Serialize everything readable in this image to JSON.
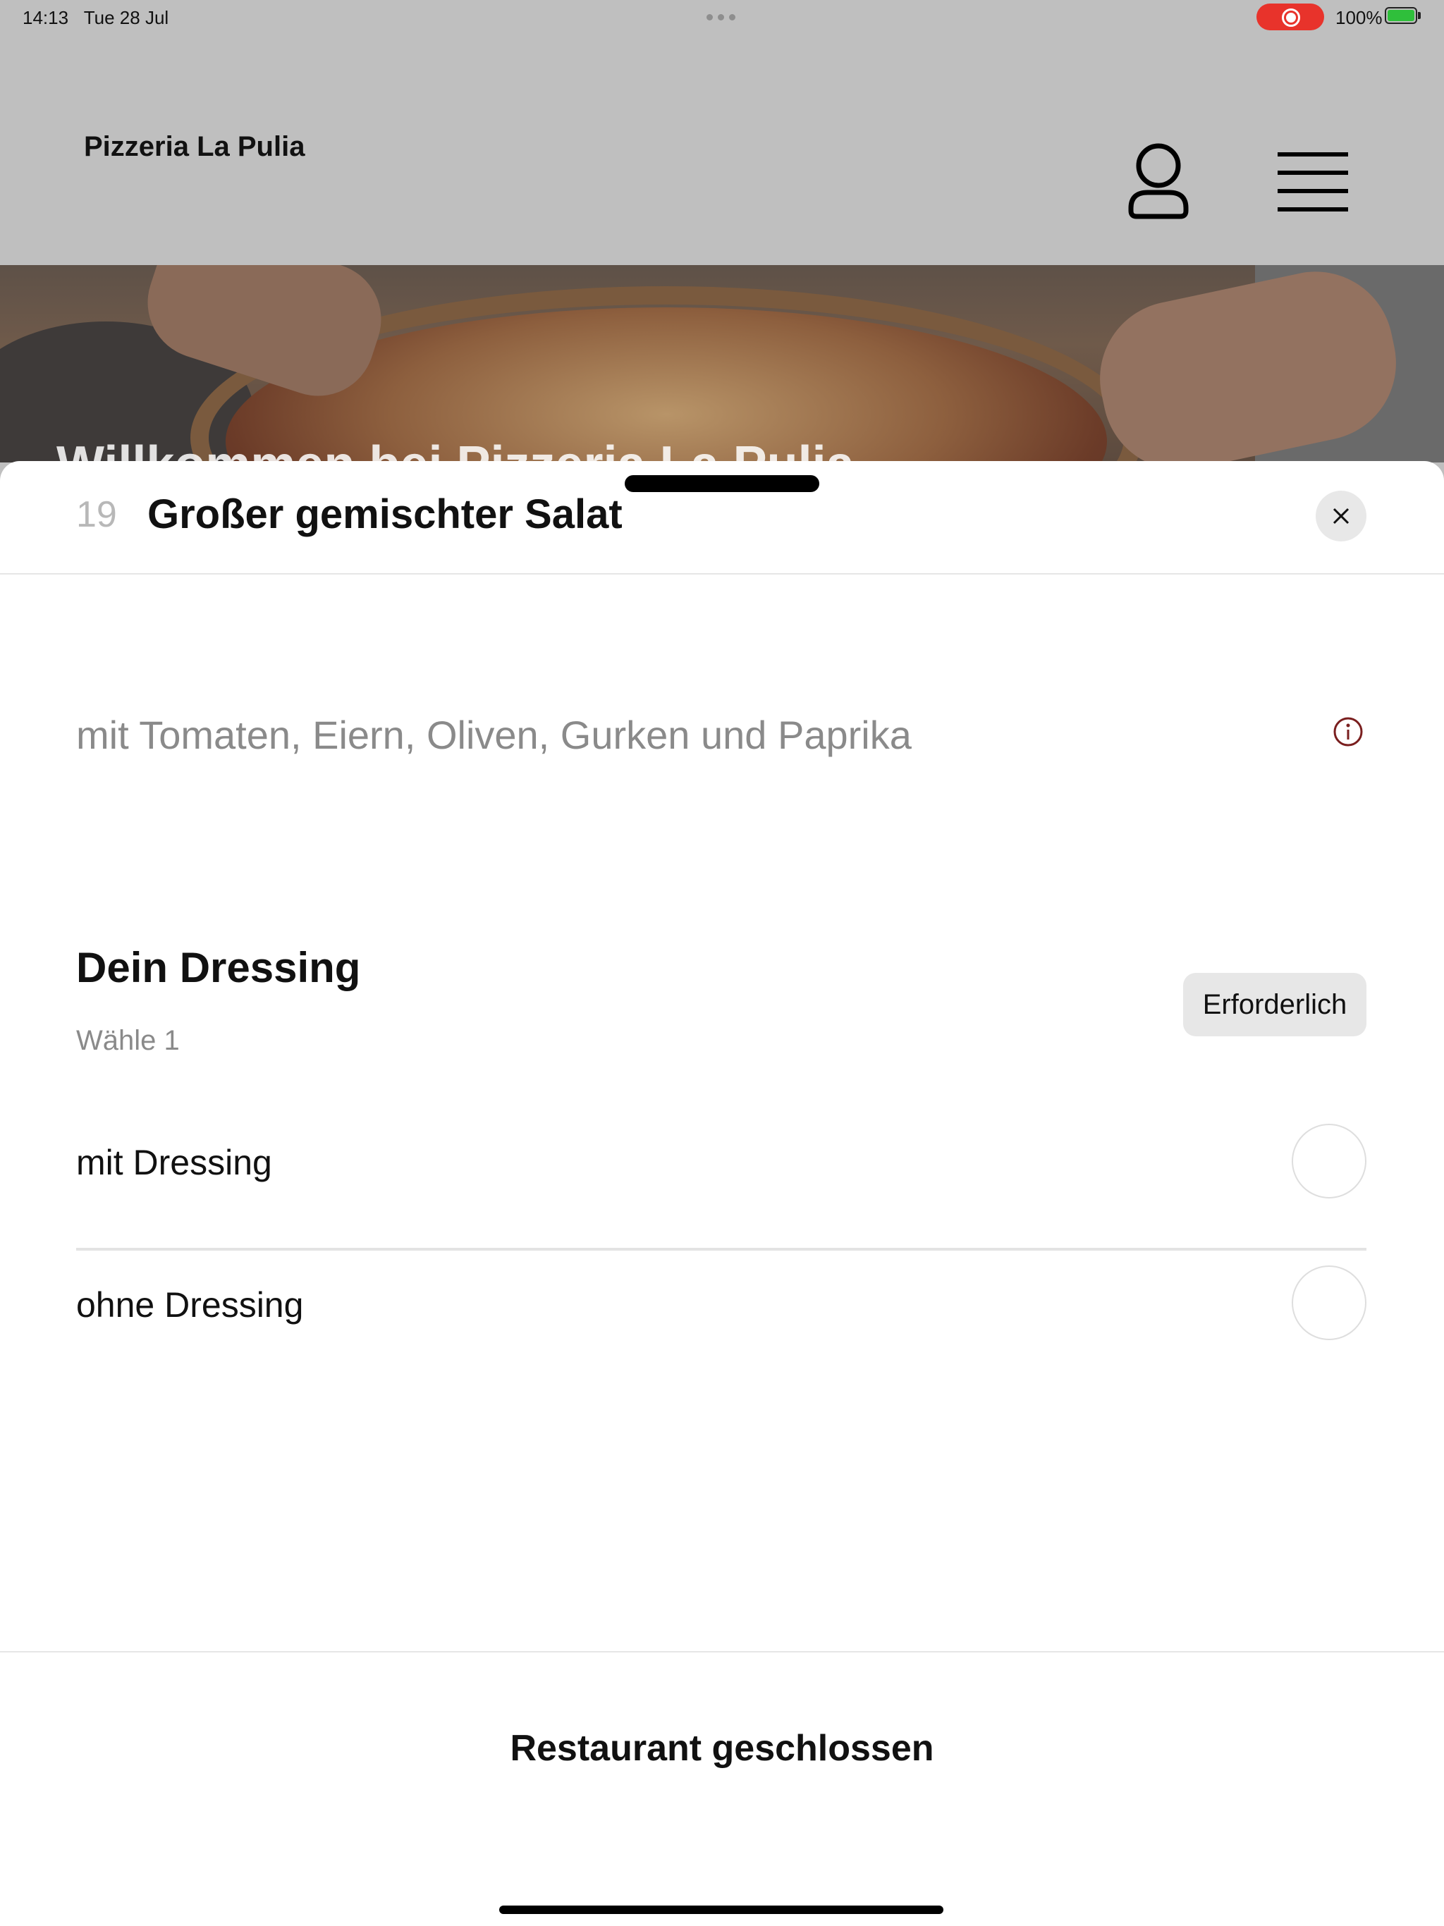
{
  "status_bar": {
    "time": "14:13",
    "date": "Tue 28 Jul",
    "battery": "100%",
    "recording_color": "#e8332b"
  },
  "header": {
    "brand": "Pizzeria La Pulia",
    "profile_icon": "person-icon",
    "menu_icon": "hamburger-icon"
  },
  "hero": {
    "title": "Willkommen bei Pizzeria La Pulia"
  },
  "sheet": {
    "item_number": "19",
    "item_title": "Großer gemischter Salat",
    "description": "mit Tomaten, Eiern, Oliven, Gurken und Paprika",
    "info_icon_color": "#7a1f1f",
    "option_group": {
      "title": "Dein Dressing",
      "subtitle": "Wähle 1",
      "badge": "Erforderlich",
      "options": [
        {
          "label": "mit Dressing",
          "selected": false
        },
        {
          "label": "ohne Dressing",
          "selected": false
        }
      ]
    },
    "footer": {
      "status": "Restaurant geschlossen"
    }
  }
}
